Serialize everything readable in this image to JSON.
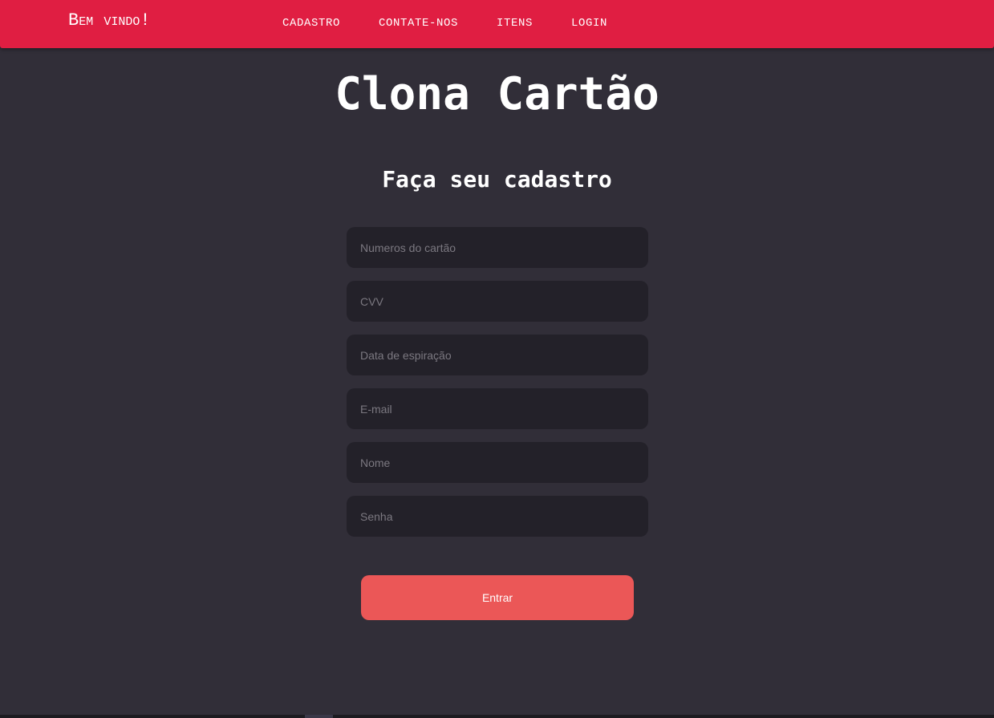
{
  "navbar": {
    "brand": "Bem vindo!",
    "links": [
      "CADASTRO",
      "CONTATE-NOS",
      "ITENS",
      "LOGIN"
    ]
  },
  "page": {
    "title": "Clona Cartão",
    "form_title": "Faça seu cadastro"
  },
  "form": {
    "fields": [
      {
        "placeholder": "Numeros do cartão",
        "value": ""
      },
      {
        "placeholder": "CVV",
        "value": ""
      },
      {
        "placeholder": "Data de espiração",
        "value": ""
      },
      {
        "placeholder": "E-mail",
        "value": ""
      },
      {
        "placeholder": "Nome",
        "value": ""
      },
      {
        "placeholder": "Senha",
        "value": ""
      }
    ],
    "submit_label": "Entrar"
  },
  "colors": {
    "navbar": "#e01e42",
    "background": "#312e38",
    "input_background": "#232129",
    "button": "#eb5757"
  }
}
